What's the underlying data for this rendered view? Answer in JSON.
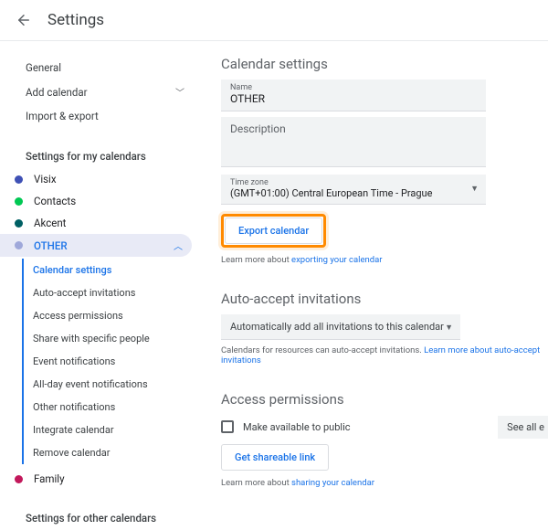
{
  "header": {
    "title": "Settings"
  },
  "sidebar": {
    "general": "General",
    "add_calendar": "Add calendar",
    "import_export": "Import & export",
    "my_cals_heading": "Settings for my calendars",
    "calendars": [
      {
        "name": "Visix",
        "color": "#3f51b5"
      },
      {
        "name": "Contacts",
        "color": "#00c853"
      },
      {
        "name": "Akcent",
        "color": "#006064"
      },
      {
        "name": "OTHER",
        "color": "#9fa8da"
      },
      {
        "name": "Family",
        "color": "#c2185b"
      }
    ],
    "subitems": [
      "Calendar settings",
      "Auto-accept invitations",
      "Access permissions",
      "Share with specific people",
      "Event notifications",
      "All-day event notifications",
      "Other notifications",
      "Integrate calendar",
      "Remove calendar"
    ],
    "other_cals_heading": "Settings for other calendars"
  },
  "main": {
    "calendar_settings_title": "Calendar settings",
    "name_label": "Name",
    "name_value": "OTHER",
    "desc_label": "Description",
    "tz_label": "Time zone",
    "tz_value": "(GMT+01:00) Central European Time - Prague",
    "export_btn": "Export calendar",
    "export_hint_pre": "Learn more about ",
    "export_hint_link": "exporting your calendar",
    "auto_accept_title": "Auto-accept invitations",
    "auto_accept_option": "Automatically add all invitations to this calendar",
    "auto_accept_hint_pre": "Calendars for resources can auto-accept invitations. ",
    "auto_accept_hint_link": "Learn more about auto-accept invitations",
    "access_title": "Access permissions",
    "public_label": "Make available to public",
    "see_all": "See all e",
    "share_btn": "Get shareable link",
    "share_hint_pre": "Learn more about ",
    "share_hint_link": "sharing your calendar"
  },
  "colors": {
    "accent": "#1a73e8",
    "highlight": "#ff8a00"
  }
}
